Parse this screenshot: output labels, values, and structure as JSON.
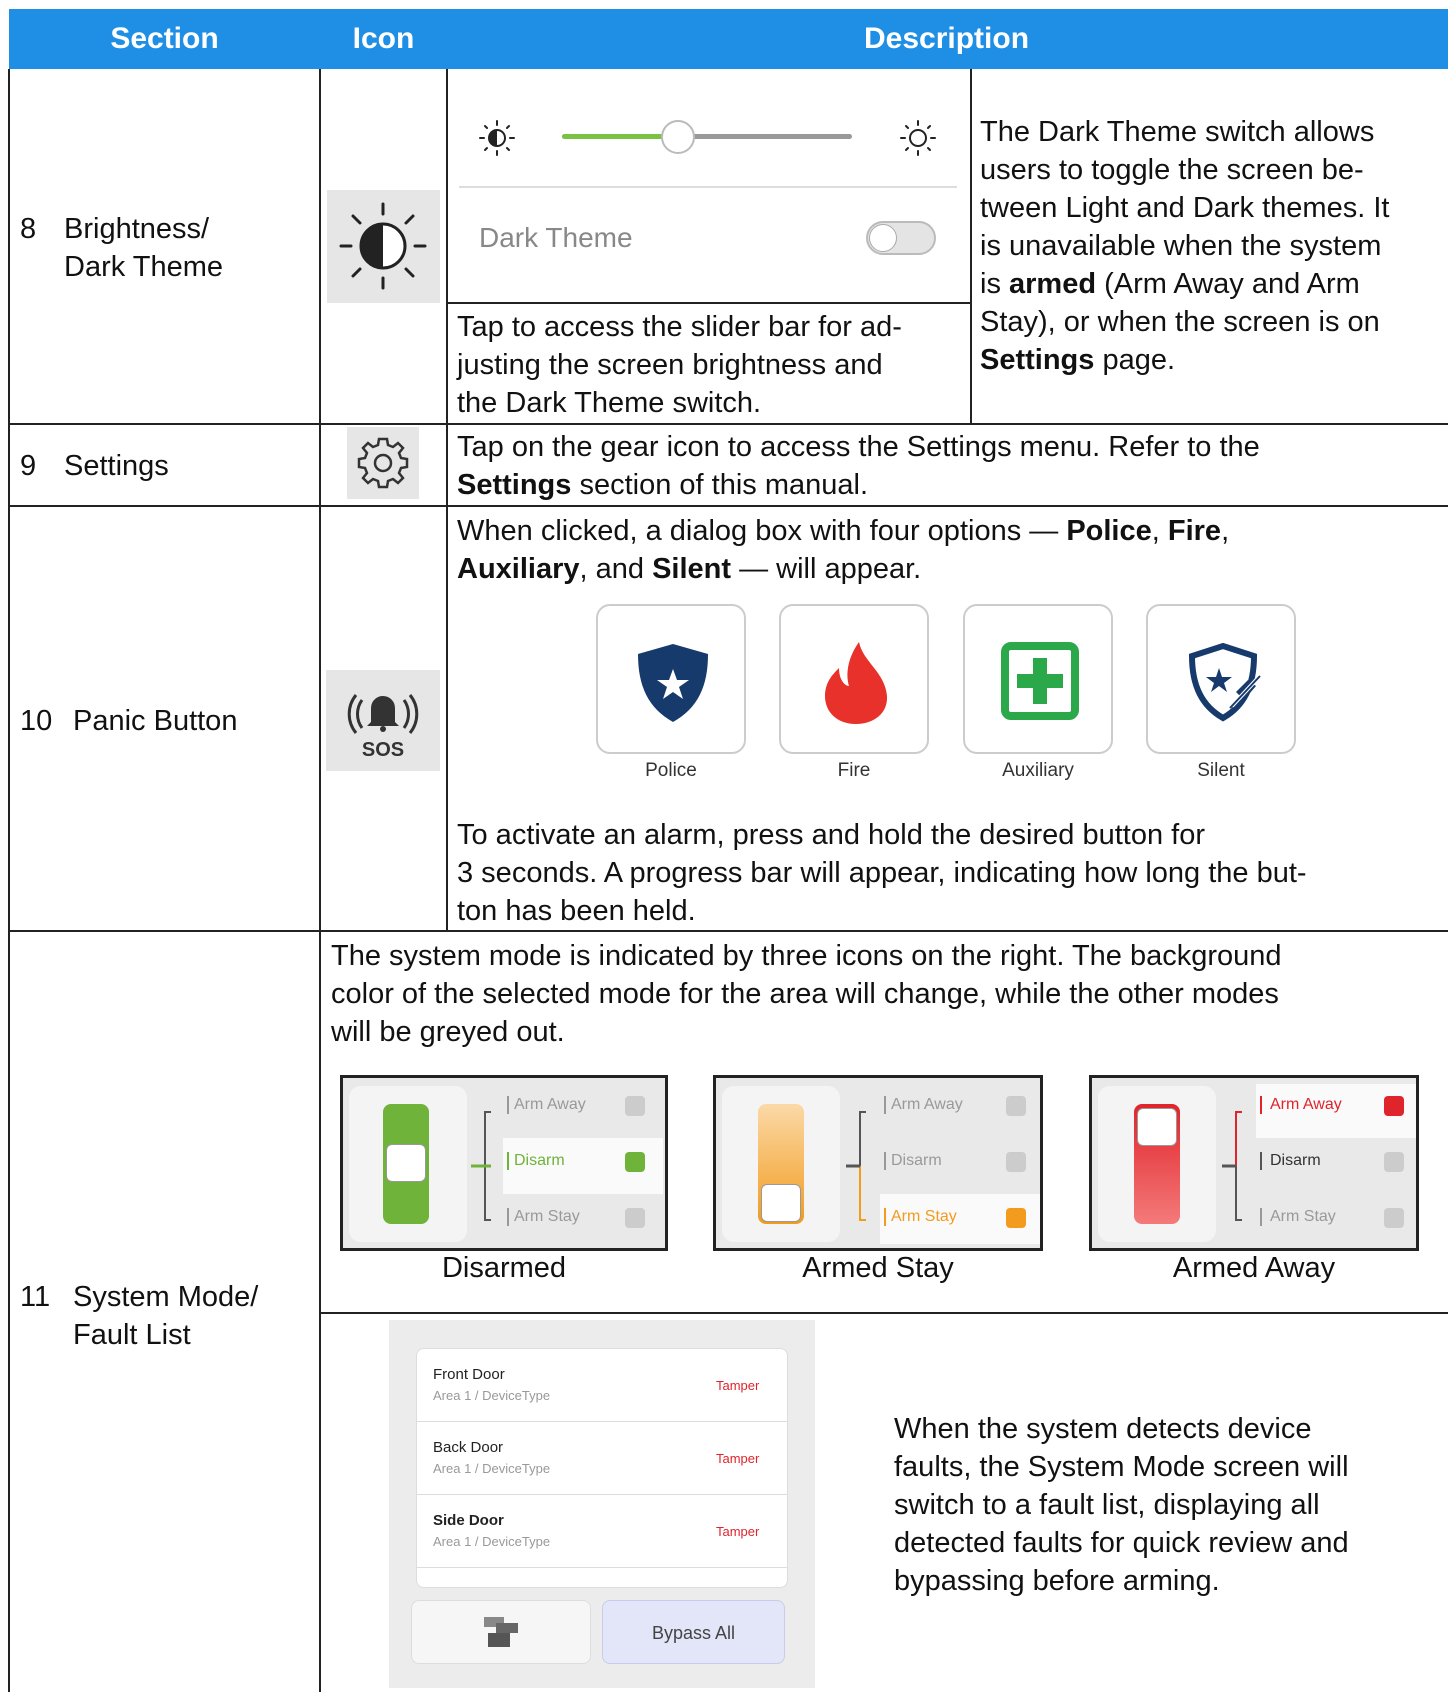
{
  "header": {
    "section": "Section",
    "icon": "Icon",
    "description": "Description"
  },
  "rows": {
    "brightness": {
      "number": "8",
      "title_line1": "Brightness/",
      "title_line2": "Dark Theme",
      "icon": "brightness-icon",
      "dark_theme_label": "Dark Theme",
      "brightness_level": 0.4,
      "dark_theme_on": false,
      "tap_text": [
        "Tap to access the slider bar for ad-",
        "justing the screen brightness and",
        "the Dark Theme switch."
      ],
      "right_text": {
        "l1": "The Dark Theme switch allows",
        "l2": "users to toggle the screen be-",
        "l3": "tween Light and Dark themes. It",
        "l4": "is unavailable when the system",
        "l5_a": "is ",
        "l5_b": "armed",
        "l5_c": " (Arm Away and Arm",
        "l6": "Stay), or when the screen is on",
        "l7_b": "Settings",
        "l7_c": " page."
      }
    },
    "settings": {
      "number": "9",
      "title": "Settings",
      "icon": "gear-icon",
      "l1": "Tap on the gear icon to access the Settings menu. Refer to the",
      "l2_b": "Settings",
      "l2_c": " section of this manual."
    },
    "panic": {
      "number": "10",
      "title": "Panic Button",
      "icon": "sos-icon",
      "icon_text": "SOS",
      "intro": {
        "a": "When clicked, a dialog box with four options — ",
        "police": "Police",
        "sep1": ", ",
        "fire": "Fire",
        "sep2": ",",
        "aux": "Auxiliary",
        "sep3": ", and ",
        "silent": "Silent",
        "end": " — will appear."
      },
      "options": [
        "Police",
        "Fire",
        "Auxiliary",
        "Silent"
      ],
      "activate": [
        "To activate an alarm, press and hold the desired button for",
        "3 seconds. A progress bar will appear, indicating how long the but-",
        "ton has been held."
      ]
    },
    "system_mode": {
      "number": "11",
      "title_line1": "System Mode/",
      "title_line2": "Fault List",
      "intro": [
        "The system mode is indicated by three icons on the right. The background",
        "color of the selected mode for the area will change, while the other modes",
        "will be greyed out."
      ],
      "modes": [
        {
          "caption": "Disarmed",
          "arm_away": "Arm Away",
          "disarm": "Disarm",
          "arm_stay": "Arm Stay",
          "color": "#6fb33a"
        },
        {
          "caption": "Armed Stay",
          "arm_away": "Arm Away",
          "disarm": "Disarm",
          "arm_stay": "Arm Stay",
          "color": "#f29b1d"
        },
        {
          "caption": "Armed Away",
          "arm_away": "Arm Away",
          "disarm": "Disarm",
          "arm_stay": "Arm Stay",
          "color": "#e0242b"
        }
      ],
      "faults": [
        {
          "name": "Front Door",
          "sub": "Area 1 / DeviceType",
          "status": "Tamper"
        },
        {
          "name": "Back Door",
          "sub": "Area 1 / DeviceType",
          "status": "Tamper"
        },
        {
          "name": "Side Door",
          "sub": "Area 1 / DeviceType",
          "status": "Tamper"
        }
      ],
      "bypass_label": "Bypass All",
      "fault_text": [
        "When the system detects device",
        "faults, the System Mode screen will",
        "switch to a fault list, displaying all",
        "detected faults for quick review and",
        "bypassing before arming."
      ]
    }
  },
  "colors": {
    "header": "#1f8fe6",
    "police": "#163a6c",
    "fire": "#e8312a",
    "aux": "#2aa84a",
    "tamper": "#e0242b"
  }
}
